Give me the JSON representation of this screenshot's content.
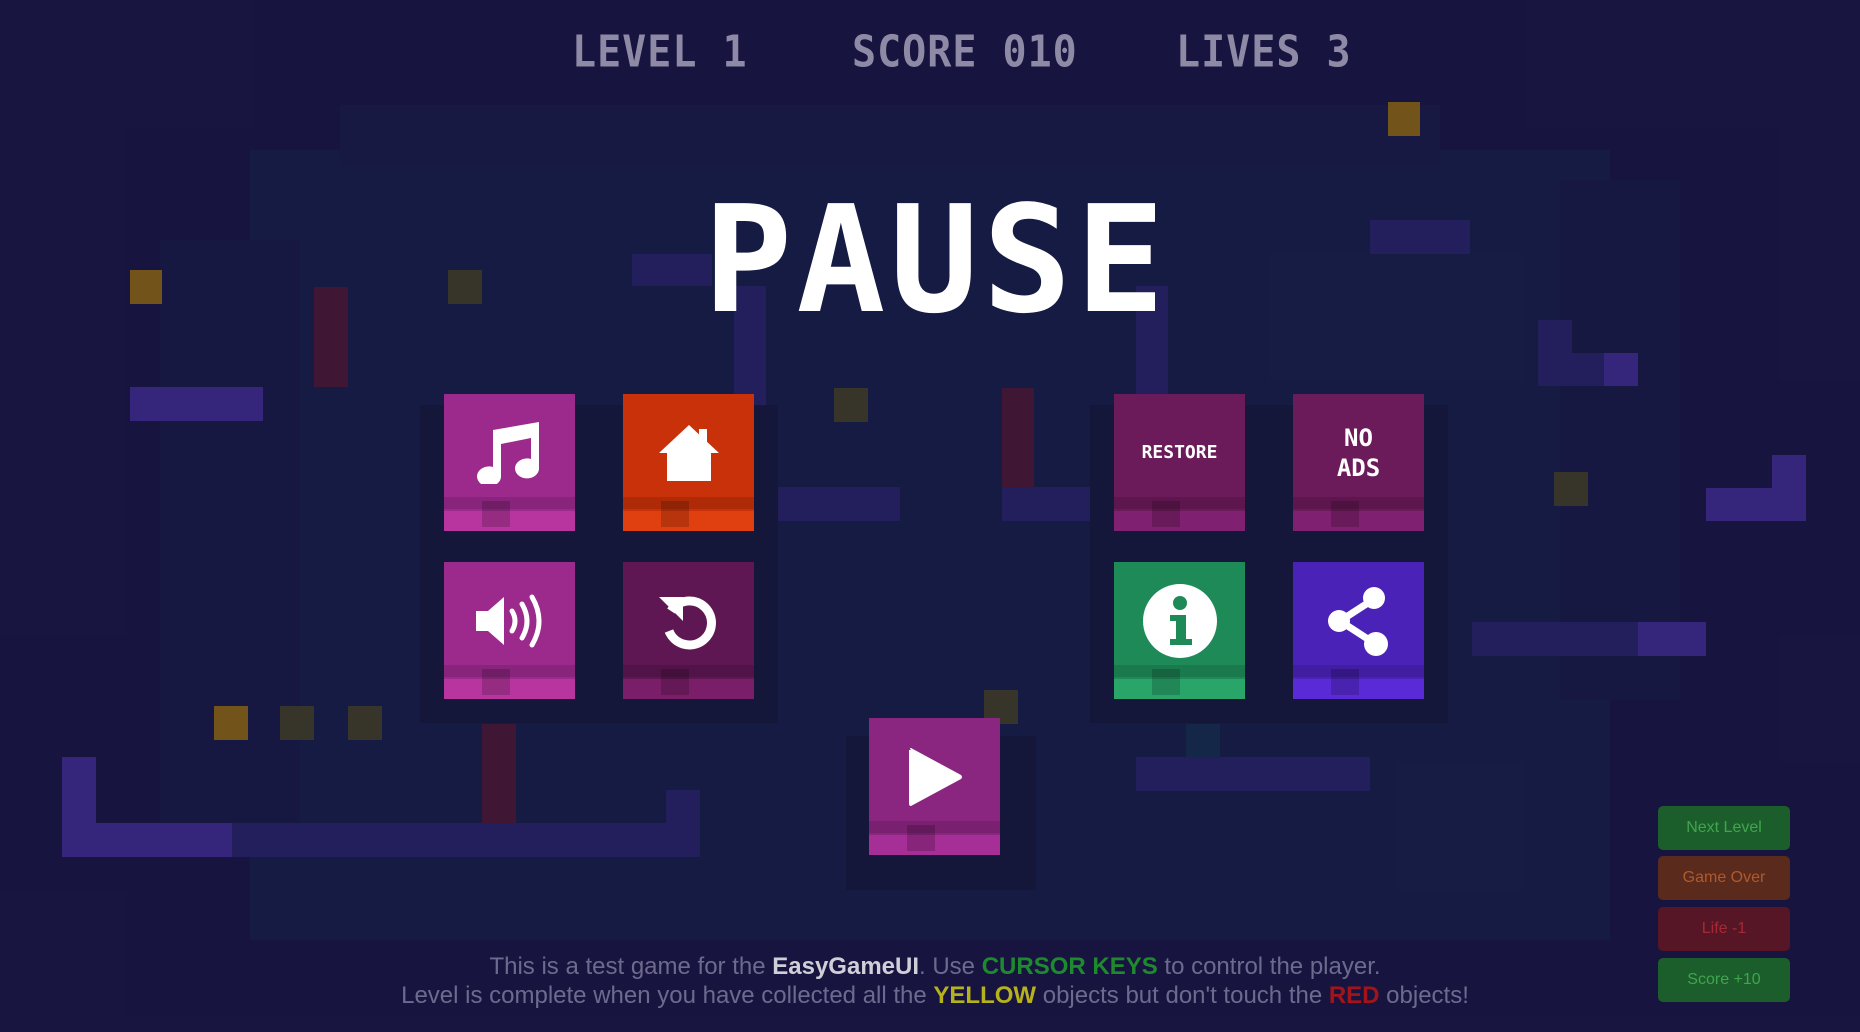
{
  "hud": {
    "level": "LEVEL 1",
    "score": "SCORE 010",
    "lives": "LIVES 3"
  },
  "pause_title": "PAUSE",
  "buttons": {
    "music": {
      "icon": "music-note-icon",
      "color": "#9b2a8c",
      "stripe": "#b8359f"
    },
    "home": {
      "icon": "home-icon",
      "color": "#c8310a",
      "stripe": "#e0400f"
    },
    "sound": {
      "icon": "speaker-icon",
      "color": "#9b2a8c",
      "stripe": "#b8359f"
    },
    "restart": {
      "icon": "restart-icon",
      "color": "#5e1752",
      "stripe": "#7a1e6a"
    },
    "restore": {
      "label": "RESTORE",
      "color": "#6b1a5a",
      "stripe": "#7f2070"
    },
    "no_ads": {
      "label_line1": "NO",
      "label_line2": "ADS",
      "color": "#6b1a5a",
      "stripe": "#7f2070"
    },
    "info": {
      "icon": "info-icon",
      "color": "#1e8a58",
      "stripe": "#2aa56a"
    },
    "share": {
      "icon": "share-icon",
      "color": "#4a22b8",
      "stripe": "#5a2ad6"
    },
    "play": {
      "icon": "play-icon",
      "color": "#8a2580",
      "stripe": "#a52e97"
    }
  },
  "debug_buttons": {
    "next_level": {
      "label": "Next Level",
      "bg": "#1c5d2c",
      "color": "#3fa54e"
    },
    "game_over": {
      "label": "Game Over",
      "bg": "#5a2a1c",
      "color": "#b05a2c"
    },
    "life_minus": {
      "label": "Life -1",
      "bg": "#561626",
      "color": "#a52a36"
    },
    "score_plus": {
      "label": "Score +10",
      "bg": "#1c5d2c",
      "color": "#3fa54e"
    }
  },
  "instructions": {
    "line1_a": "This is a test game for the ",
    "line1_brand": "EasyGameUI",
    "line1_b": ". Use ",
    "line1_keys": "CURSOR KEYS",
    "line1_c": " to control the player.",
    "line2_a": "Level is complete when you have collected all the ",
    "line2_yellow": "YELLOW",
    "line2_b": " objects but don't touch the ",
    "line2_red": "RED",
    "line2_c": " objects!"
  },
  "colors": {
    "background": "#1e1a4e",
    "playfield": "#1b2454",
    "wall": "#43339a",
    "hazard": "#6a1e3a",
    "collectible_yellow": "#c09013",
    "collectible_dim": "#4d4a2a",
    "keys_green": "#1e8a2e",
    "yellow_word": "#b5b21c",
    "red_word": "#a3141a",
    "brand_word": "#cfcfd8"
  }
}
